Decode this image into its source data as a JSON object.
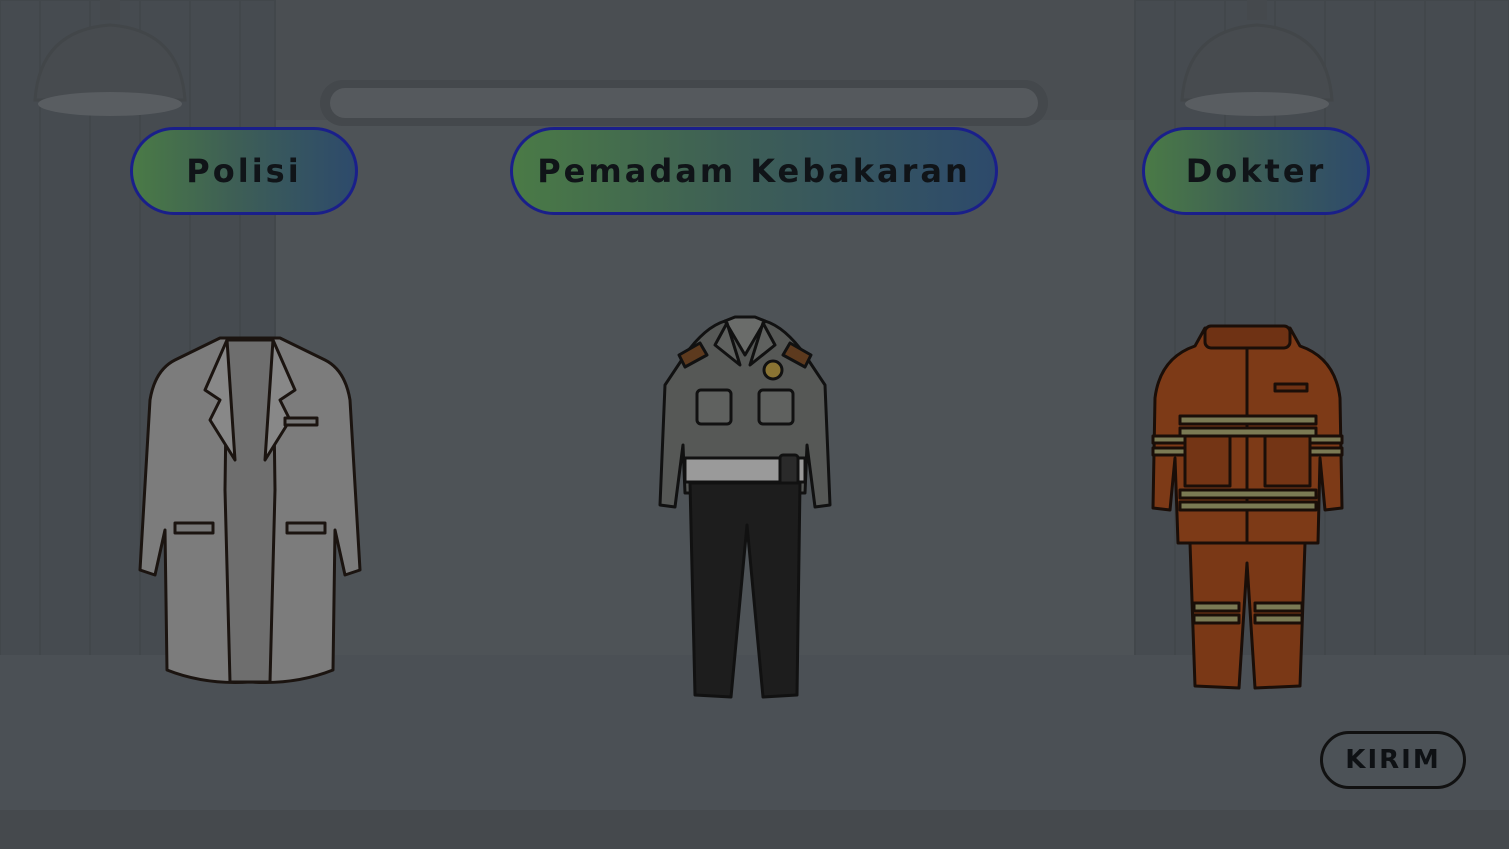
{
  "labels": {
    "polisi": "Polisi",
    "pemadam": "Pemadam Kebakaran",
    "dokter": "Dokter"
  },
  "submit_label": "KIRIM",
  "outfits": [
    {
      "name": "doctor-coat",
      "icon": "lab-coat-icon"
    },
    {
      "name": "police-uniform",
      "icon": "police-uniform-icon"
    },
    {
      "name": "firefighter-suit",
      "icon": "firefighter-suit-icon"
    }
  ],
  "colors": {
    "background": "#4b4f53",
    "label_border": "#1a1f8a",
    "label_gradient_start": "#4a7a46",
    "label_gradient_end": "#2d4a6b"
  }
}
